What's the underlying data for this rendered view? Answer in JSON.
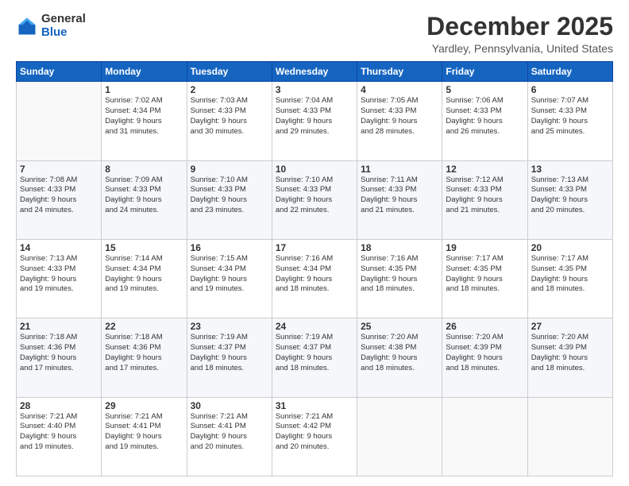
{
  "logo": {
    "general": "General",
    "blue": "Blue"
  },
  "title": "December 2025",
  "subtitle": "Yardley, Pennsylvania, United States",
  "days_header": [
    "Sunday",
    "Monday",
    "Tuesday",
    "Wednesday",
    "Thursday",
    "Friday",
    "Saturday"
  ],
  "weeks": [
    [
      {
        "day": "",
        "info": ""
      },
      {
        "day": "1",
        "info": "Sunrise: 7:02 AM\nSunset: 4:34 PM\nDaylight: 9 hours\nand 31 minutes."
      },
      {
        "day": "2",
        "info": "Sunrise: 7:03 AM\nSunset: 4:33 PM\nDaylight: 9 hours\nand 30 minutes."
      },
      {
        "day": "3",
        "info": "Sunrise: 7:04 AM\nSunset: 4:33 PM\nDaylight: 9 hours\nand 29 minutes."
      },
      {
        "day": "4",
        "info": "Sunrise: 7:05 AM\nSunset: 4:33 PM\nDaylight: 9 hours\nand 28 minutes."
      },
      {
        "day": "5",
        "info": "Sunrise: 7:06 AM\nSunset: 4:33 PM\nDaylight: 9 hours\nand 26 minutes."
      },
      {
        "day": "6",
        "info": "Sunrise: 7:07 AM\nSunset: 4:33 PM\nDaylight: 9 hours\nand 25 minutes."
      }
    ],
    [
      {
        "day": "7",
        "info": "Sunrise: 7:08 AM\nSunset: 4:33 PM\nDaylight: 9 hours\nand 24 minutes."
      },
      {
        "day": "8",
        "info": "Sunrise: 7:09 AM\nSunset: 4:33 PM\nDaylight: 9 hours\nand 24 minutes."
      },
      {
        "day": "9",
        "info": "Sunrise: 7:10 AM\nSunset: 4:33 PM\nDaylight: 9 hours\nand 23 minutes."
      },
      {
        "day": "10",
        "info": "Sunrise: 7:10 AM\nSunset: 4:33 PM\nDaylight: 9 hours\nand 22 minutes."
      },
      {
        "day": "11",
        "info": "Sunrise: 7:11 AM\nSunset: 4:33 PM\nDaylight: 9 hours\nand 21 minutes."
      },
      {
        "day": "12",
        "info": "Sunrise: 7:12 AM\nSunset: 4:33 PM\nDaylight: 9 hours\nand 21 minutes."
      },
      {
        "day": "13",
        "info": "Sunrise: 7:13 AM\nSunset: 4:33 PM\nDaylight: 9 hours\nand 20 minutes."
      }
    ],
    [
      {
        "day": "14",
        "info": "Sunrise: 7:13 AM\nSunset: 4:33 PM\nDaylight: 9 hours\nand 19 minutes."
      },
      {
        "day": "15",
        "info": "Sunrise: 7:14 AM\nSunset: 4:34 PM\nDaylight: 9 hours\nand 19 minutes."
      },
      {
        "day": "16",
        "info": "Sunrise: 7:15 AM\nSunset: 4:34 PM\nDaylight: 9 hours\nand 19 minutes."
      },
      {
        "day": "17",
        "info": "Sunrise: 7:16 AM\nSunset: 4:34 PM\nDaylight: 9 hours\nand 18 minutes."
      },
      {
        "day": "18",
        "info": "Sunrise: 7:16 AM\nSunset: 4:35 PM\nDaylight: 9 hours\nand 18 minutes."
      },
      {
        "day": "19",
        "info": "Sunrise: 7:17 AM\nSunset: 4:35 PM\nDaylight: 9 hours\nand 18 minutes."
      },
      {
        "day": "20",
        "info": "Sunrise: 7:17 AM\nSunset: 4:35 PM\nDaylight: 9 hours\nand 18 minutes."
      }
    ],
    [
      {
        "day": "21",
        "info": "Sunrise: 7:18 AM\nSunset: 4:36 PM\nDaylight: 9 hours\nand 17 minutes."
      },
      {
        "day": "22",
        "info": "Sunrise: 7:18 AM\nSunset: 4:36 PM\nDaylight: 9 hours\nand 17 minutes."
      },
      {
        "day": "23",
        "info": "Sunrise: 7:19 AM\nSunset: 4:37 PM\nDaylight: 9 hours\nand 18 minutes."
      },
      {
        "day": "24",
        "info": "Sunrise: 7:19 AM\nSunset: 4:37 PM\nDaylight: 9 hours\nand 18 minutes."
      },
      {
        "day": "25",
        "info": "Sunrise: 7:20 AM\nSunset: 4:38 PM\nDaylight: 9 hours\nand 18 minutes."
      },
      {
        "day": "26",
        "info": "Sunrise: 7:20 AM\nSunset: 4:39 PM\nDaylight: 9 hours\nand 18 minutes."
      },
      {
        "day": "27",
        "info": "Sunrise: 7:20 AM\nSunset: 4:39 PM\nDaylight: 9 hours\nand 18 minutes."
      }
    ],
    [
      {
        "day": "28",
        "info": "Sunrise: 7:21 AM\nSunset: 4:40 PM\nDaylight: 9 hours\nand 19 minutes."
      },
      {
        "day": "29",
        "info": "Sunrise: 7:21 AM\nSunset: 4:41 PM\nDaylight: 9 hours\nand 19 minutes."
      },
      {
        "day": "30",
        "info": "Sunrise: 7:21 AM\nSunset: 4:41 PM\nDaylight: 9 hours\nand 20 minutes."
      },
      {
        "day": "31",
        "info": "Sunrise: 7:21 AM\nSunset: 4:42 PM\nDaylight: 9 hours\nand 20 minutes."
      },
      {
        "day": "",
        "info": ""
      },
      {
        "day": "",
        "info": ""
      },
      {
        "day": "",
        "info": ""
      }
    ]
  ]
}
